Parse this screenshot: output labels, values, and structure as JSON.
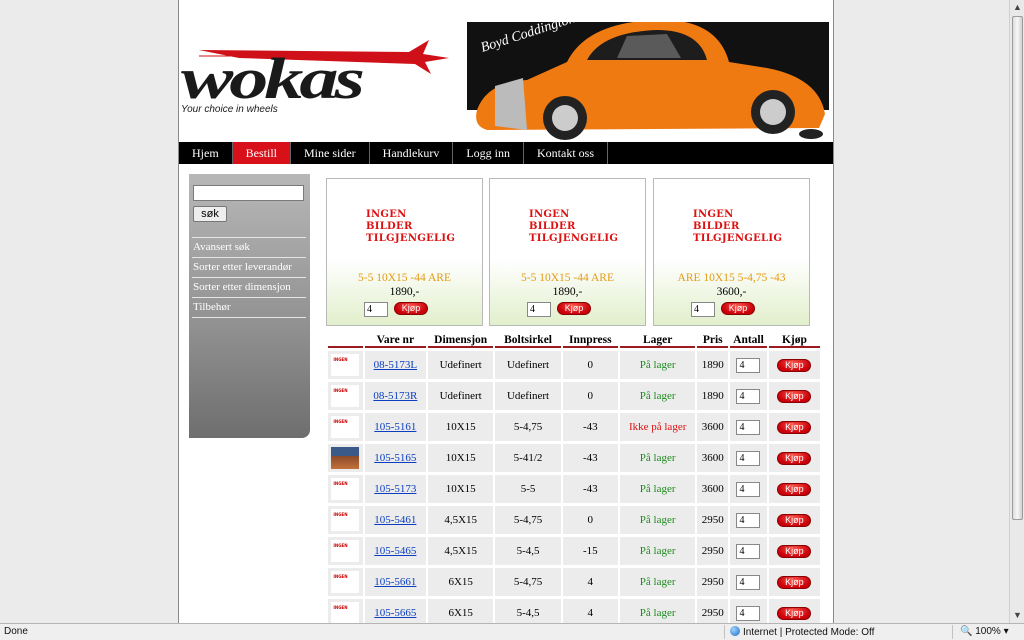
{
  "logo": {
    "text": "wokas",
    "tagline": "Your choice in wheels",
    "signature": "Boyd Coddington"
  },
  "nav": [
    {
      "label": "Hjem",
      "active": false
    },
    {
      "label": "Bestill",
      "active": true
    },
    {
      "label": "Mine sider",
      "active": false
    },
    {
      "label": "Handlekurv",
      "active": false
    },
    {
      "label": "Logg inn",
      "active": false
    },
    {
      "label": "Kontakt oss",
      "active": false
    }
  ],
  "sidebar": {
    "search_value": "",
    "search_button": "søk",
    "links": [
      "Avansert søk",
      "Sorter etter leverandør",
      "Sorter etter dimensjon",
      "Tilbehør"
    ]
  },
  "no_image_text": [
    "INGEN",
    "BILDER",
    "TILGJENGELIG"
  ],
  "featured": [
    {
      "name": "5-5 10X15 -44 ARE",
      "price": "1890,-",
      "qty": "4",
      "buy": "Kjøp"
    },
    {
      "name": "5-5 10X15 -44 ARE",
      "price": "1890,-",
      "qty": "4",
      "buy": "Kjøp"
    },
    {
      "name": "ARE 10X15 5-4,75 -43",
      "price": "3600,-",
      "qty": "4",
      "buy": "Kjøp"
    }
  ],
  "table": {
    "headers": [
      "",
      "Vare nr",
      "Dimensjon",
      "Boltsirkel",
      "Innpress",
      "Lager",
      "Pris",
      "Antall",
      "Kjøp"
    ],
    "rows": [
      {
        "img": "no-image",
        "vare": "08-5173L",
        "dim": "Udefinert",
        "bolt": "Udefinert",
        "innpress": "0",
        "lager": "På lager",
        "in_stock": true,
        "pris": "1890",
        "antall": "4",
        "buy": "Kjøp"
      },
      {
        "img": "no-image",
        "vare": "08-5173R",
        "dim": "Udefinert",
        "bolt": "Udefinert",
        "innpress": "0",
        "lager": "På lager",
        "in_stock": true,
        "pris": "1890",
        "antall": "4",
        "buy": "Kjøp"
      },
      {
        "img": "no-image",
        "vare": "105-5161",
        "dim": "10X15",
        "bolt": "5-4,75",
        "innpress": "-43",
        "lager": "Ikke på lager",
        "in_stock": false,
        "pris": "3600",
        "antall": "4",
        "buy": "Kjøp"
      },
      {
        "img": "photo",
        "vare": "105-5165",
        "dim": "10X15",
        "bolt": "5-41/2",
        "innpress": "-43",
        "lager": "På lager",
        "in_stock": true,
        "pris": "3600",
        "antall": "4",
        "buy": "Kjøp"
      },
      {
        "img": "no-image",
        "vare": "105-5173",
        "dim": "10X15",
        "bolt": "5-5",
        "innpress": "-43",
        "lager": "På lager",
        "in_stock": true,
        "pris": "3600",
        "antall": "4",
        "buy": "Kjøp"
      },
      {
        "img": "no-image",
        "vare": "105-5461",
        "dim": "4,5X15",
        "bolt": "5-4,75",
        "innpress": "0",
        "lager": "På lager",
        "in_stock": true,
        "pris": "2950",
        "antall": "4",
        "buy": "Kjøp"
      },
      {
        "img": "no-image",
        "vare": "105-5465",
        "dim": "4,5X15",
        "bolt": "5-4,5",
        "innpress": "-15",
        "lager": "På lager",
        "in_stock": true,
        "pris": "2950",
        "antall": "4",
        "buy": "Kjøp"
      },
      {
        "img": "no-image",
        "vare": "105-5661",
        "dim": "6X15",
        "bolt": "5-4,75",
        "innpress": "4",
        "lager": "På lager",
        "in_stock": true,
        "pris": "2950",
        "antall": "4",
        "buy": "Kjøp"
      },
      {
        "img": "no-image",
        "vare": "105-5665",
        "dim": "6X15",
        "bolt": "5-4,5",
        "innpress": "4",
        "lager": "På lager",
        "in_stock": true,
        "pris": "2950",
        "antall": "4",
        "buy": "Kjøp"
      }
    ]
  },
  "status": {
    "left": "Done",
    "zone": "Internet | Protected Mode: Off",
    "zoom": "100%"
  },
  "colors": {
    "nav_active": "#d8101a",
    "in_stock": "#1f8a1f",
    "out_of_stock": "#dd1111",
    "featured_name": "#e59a13",
    "link": "#0b3fc0"
  }
}
